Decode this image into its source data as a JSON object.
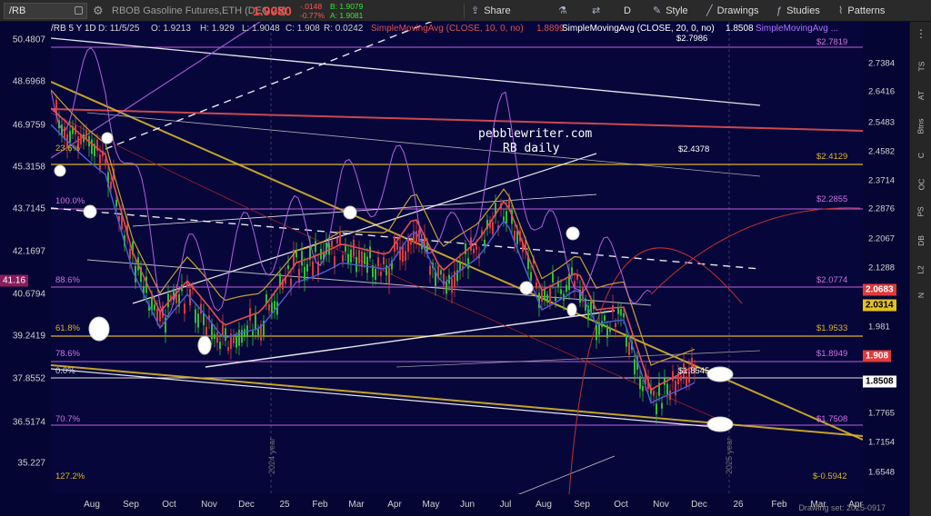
{
  "toolbar": {
    "symbol": "/RB",
    "product": "RBOB Gasoline Futures,ETH (DEC 25)",
    "last_price": "1.9080",
    "net_change": "-.0148",
    "pct_change": "-0.77%",
    "bid": "B: 1.9079",
    "ask": "A: 1.9081",
    "share_label": "Share",
    "period_label": "D",
    "style_label": "Style",
    "drawings_label": "Drawings",
    "studies_label": "Studies",
    "patterns_label": "Patterns"
  },
  "sidebar": {
    "items": [
      "TS",
      "AT",
      "Btns",
      "C",
      "OC",
      "PS",
      "DB",
      "L2",
      "N"
    ]
  },
  "legend": {
    "header": "/RB 5 Y 1D",
    "date": "D: 11/5/25",
    "open": "O: 1.9213",
    "high": "H: 1.929",
    "low": "L: 1.9048",
    "close": "C: 1.908",
    "range": "R: 0.0242",
    "sma10": "SimpleMovingAvg (CLOSE, 10, 0, no)",
    "sma10_value": "1.8899",
    "sma20": "SimpleMovingAvg (CLOSE, 20, 0, no)",
    "sma20_value": "1.8508",
    "sma_extra": "SimpleMovingAvg ..."
  },
  "watermark": {
    "line1": "pebblewriter.com",
    "line2": "RB daily"
  },
  "left_axis": [
    "50.4807",
    "48.6968",
    "46.9759",
    "45.3158",
    "43.7145",
    "42.1697",
    "41.16",
    "40.6794",
    "39.2419",
    "37.8552",
    "36.5174",
    "35.227"
  ],
  "right_axis": [
    "2.7384",
    "2.6416",
    "2.5483",
    "2.4582",
    "2.3714",
    "2.2876",
    "2.2067",
    "2.1288",
    "1.981",
    "1.7765",
    "1.7154",
    "1.6548"
  ],
  "x_axis": [
    "Aug",
    "Sep",
    "Oct",
    "Nov",
    "Dec",
    "25",
    "Feb",
    "Mar",
    "Apr",
    "May",
    "Jun",
    "Jul",
    "Aug",
    "Sep",
    "Oct",
    "Nov",
    "Dec",
    "26",
    "Feb",
    "Mar",
    "Apr"
  ],
  "fib_left": [
    "23.6%",
    "100.0%",
    "88.6%",
    "61.8%",
    "78.6%",
    "0.0%",
    "70.7%",
    "127.2%"
  ],
  "fib_right": [
    "$2.7819",
    "$2.4129",
    "$2.2855",
    "$2.0774",
    "$1.9533",
    "$1.8949",
    "$1.7508",
    "$-0.5942"
  ],
  "price_labels": [
    "$2.7986",
    "$2.4378",
    "$1.8545"
  ],
  "right_tags": {
    "red": "2.0683",
    "yellow": "2.0314",
    "last": "1.908",
    "white": "1.8508"
  },
  "vertical_labels": [
    "2024 year",
    "2025 year"
  ],
  "drawing_set": "Drawing set: 2025-0917",
  "colors": {
    "background": "#06063a",
    "price_up": "#2fbf2f",
    "price_down": "#d83a3a",
    "sma_red": "#e05050",
    "fib_yellow": "#d8b42a",
    "fib_purple": "#c060e0"
  }
}
